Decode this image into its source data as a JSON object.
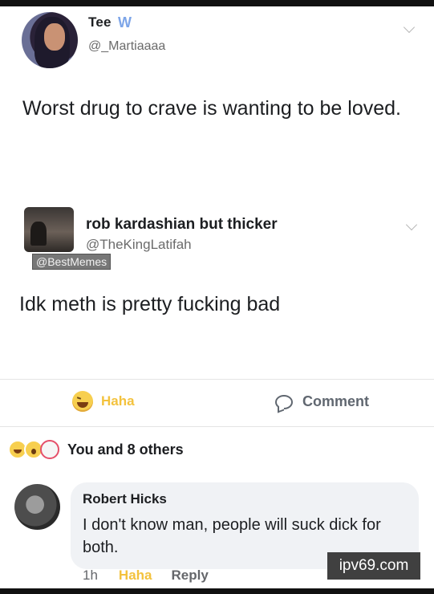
{
  "tweet": {
    "author_name": "Tee",
    "author_badge": "W",
    "author_handle": "@_Martiaaaa",
    "text": "Worst drug to crave is wanting to be loved."
  },
  "reply_tweet": {
    "author_name": "rob kardashian but thicker",
    "author_handle": "@TheKingLatifah",
    "watermark": "@BestMemes",
    "text": "Idk meth is pretty fucking bad"
  },
  "actions": {
    "reaction_label": "Haha",
    "comment_label": "Comment"
  },
  "reactions_summary": {
    "icons": [
      "haha-emoji",
      "wow-emoji",
      "love-emoji"
    ],
    "text": "You and 8 others"
  },
  "comment": {
    "author": "Robert Hicks",
    "text": "I don't know man, people will suck dick for both.",
    "time": "1h",
    "reaction_label": "Haha",
    "reply_label": "Reply"
  },
  "site_watermark": "ipv69.com",
  "colors": {
    "haha_yellow": "#f3c23d",
    "secondary_text": "#6b6b6b",
    "bubble_bg": "#f0f2f5"
  }
}
